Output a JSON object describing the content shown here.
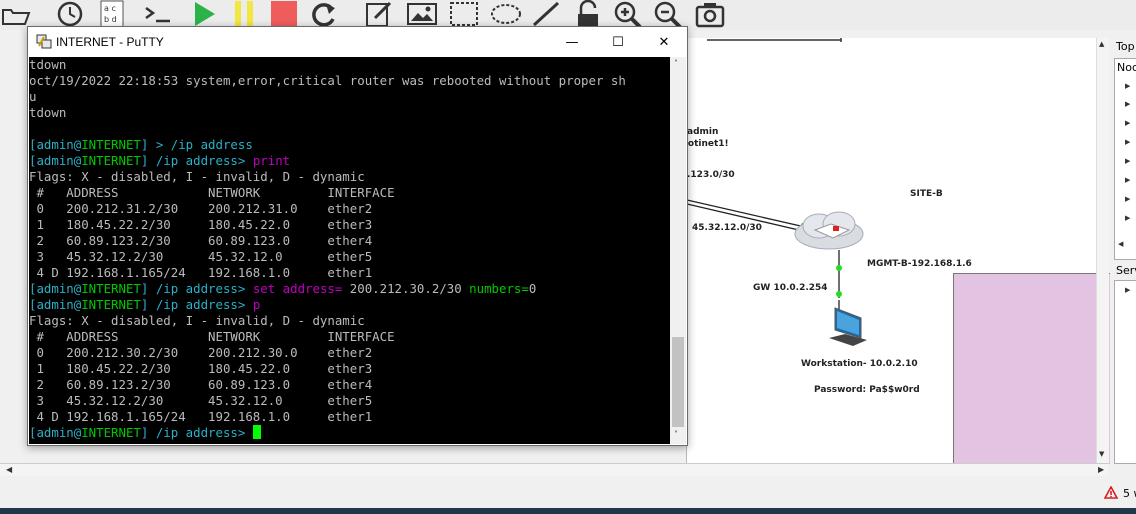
{
  "putty": {
    "title": "INTERNET - PuTTY",
    "minimize": "—",
    "maximize": "☐",
    "close": "✕"
  },
  "terminal": {
    "lines": [
      [
        {
          "t": "tdown",
          "c": ""
        }
      ],
      [
        {
          "t": "oct/19/2022 22:18:53 system,error,critical router was rebooted without proper sh",
          "c": ""
        }
      ],
      [
        {
          "t": "u",
          "c": ""
        }
      ],
      [
        {
          "t": "tdown",
          "c": ""
        }
      ],
      [
        {
          "t": "",
          "c": ""
        }
      ],
      [
        {
          "t": "[admin@",
          "c": "c"
        },
        {
          "t": "INTERNET",
          "c": "g"
        },
        {
          "t": "] > /ip address",
          "c": "c"
        }
      ],
      [
        {
          "t": "[admin@",
          "c": "c"
        },
        {
          "t": "INTERNET",
          "c": "g"
        },
        {
          "t": "] /ip address> ",
          "c": "c"
        },
        {
          "t": "print",
          "c": "m"
        }
      ],
      [
        {
          "t": "Flags: X - disabled, I - invalid, D - dynamic",
          "c": ""
        }
      ],
      [
        {
          "t": " #   ADDRESS            NETWORK         INTERFACE",
          "c": ""
        }
      ],
      [
        {
          "t": " 0   200.212.31.2/30    200.212.31.0    ether2",
          "c": ""
        }
      ],
      [
        {
          "t": " 1   180.45.22.2/30     180.45.22.0     ether3",
          "c": ""
        }
      ],
      [
        {
          "t": " 2   60.89.123.2/30     60.89.123.0     ether4",
          "c": ""
        }
      ],
      [
        {
          "t": " 3   45.32.12.2/30      45.32.12.0      ether5",
          "c": ""
        }
      ],
      [
        {
          "t": " 4 D 192.168.1.165/24   192.168.1.0     ether1",
          "c": ""
        }
      ],
      [
        {
          "t": "[admin@",
          "c": "c"
        },
        {
          "t": "INTERNET",
          "c": "g"
        },
        {
          "t": "] /ip address> ",
          "c": "c"
        },
        {
          "t": "set address= ",
          "c": "m"
        },
        {
          "t": "200.212.30.2/30 ",
          "c": ""
        },
        {
          "t": "numbers=",
          "c": "g"
        },
        {
          "t": "0",
          "c": ""
        }
      ],
      [
        {
          "t": "[admin@",
          "c": "c"
        },
        {
          "t": "INTERNET",
          "c": "g"
        },
        {
          "t": "] /ip address> ",
          "c": "c"
        },
        {
          "t": "p",
          "c": "m"
        }
      ],
      [
        {
          "t": "Flags: X - disabled, I - invalid, D - dynamic",
          "c": ""
        }
      ],
      [
        {
          "t": " #   ADDRESS            NETWORK         INTERFACE",
          "c": ""
        }
      ],
      [
        {
          "t": " 0   200.212.30.2/30    200.212.30.0    ether2",
          "c": ""
        }
      ],
      [
        {
          "t": " 1   180.45.22.2/30     180.45.22.0     ether3",
          "c": ""
        }
      ],
      [
        {
          "t": " 2   60.89.123.2/30     60.89.123.0     ether4",
          "c": ""
        }
      ],
      [
        {
          "t": " 3   45.32.12.2/30      45.32.12.0      ether5",
          "c": ""
        }
      ],
      [
        {
          "t": " 4 D 192.168.1.165/24   192.168.1.0     ether1",
          "c": ""
        }
      ],
      [
        {
          "t": "[admin@",
          "c": "c"
        },
        {
          "t": "INTERNET",
          "c": "g"
        },
        {
          "t": "] /ip address> ",
          "c": "c"
        }
      ]
    ]
  },
  "topology": {
    "admin_label": "admin",
    "password_label": "fotinet1!",
    "link_123_label": ".123.0/30",
    "site_b_label": "SITE-B",
    "link_45_label": "45.32.12.0/30",
    "mgmt_label": "MGMT-B-192.168.1.6",
    "gw_label": "GW 10.0.2.254",
    "workstation_label": "Workstation- 10.0.2.10",
    "workstation_password": "Password: Pa$$w0rd"
  },
  "right_panel": {
    "topology_header": "Top",
    "nodes_header": "Noc",
    "servers_header": "Serv"
  },
  "status": {
    "warning_text": "5 w"
  },
  "colors": {
    "terminal_bg": "#000000",
    "prompt_cyan": "#2ab0c8",
    "host_green": "#00c800",
    "command_magenta": "#c000c0",
    "cursor_green": "#00ff00",
    "link_dot_green": "#22dd22",
    "pink_area": "#e2c4e2"
  }
}
